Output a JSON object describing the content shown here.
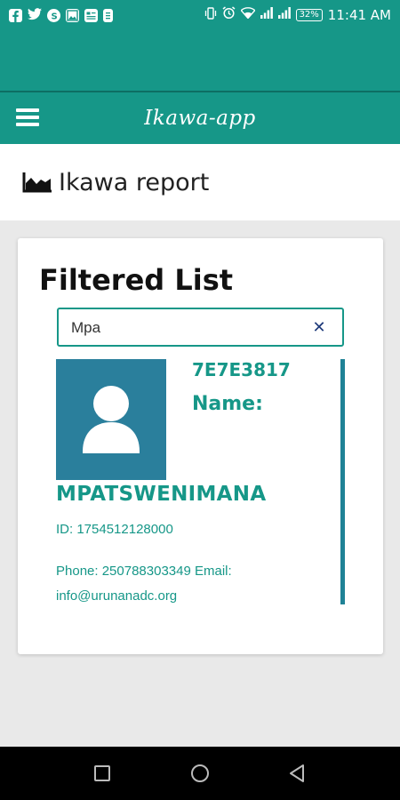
{
  "status_bar": {
    "time": "11:41 AM",
    "battery": "32%",
    "left_icons": [
      "facebook-icon",
      "twitter-icon",
      "skype-icon",
      "gallery-icon",
      "news-icon",
      "clipboard-icon"
    ],
    "right_icons": [
      "vibrate-icon",
      "alarm-icon",
      "wifi-icon",
      "signal-icon",
      "signal-icon",
      "battery-icon"
    ]
  },
  "toolbar": {
    "app_title": "Ikawa-app",
    "menu_icon": "hamburger-menu-icon"
  },
  "header": {
    "title": "Ikawa report",
    "icon": "area-chart-icon"
  },
  "card": {
    "heading": "Filtered List",
    "search": {
      "value": "Mpa",
      "clear_icon": "close-icon"
    },
    "result": {
      "code": "7E7E3817",
      "name_label": "Name:",
      "full_name": "MPATSWENIMANA",
      "id_line": "ID: 1754512128000",
      "contact_line": "Phone: 250788303349 Email: info@urunanadc.org",
      "avatar_icon": "user-avatar-icon"
    }
  },
  "nav_bar": {
    "buttons": [
      "recent-apps-icon",
      "home-icon",
      "back-icon"
    ]
  },
  "colors": {
    "primary": "#169788",
    "accent_bar": "#1f8296",
    "avatar_bg": "#2a7f9c"
  }
}
